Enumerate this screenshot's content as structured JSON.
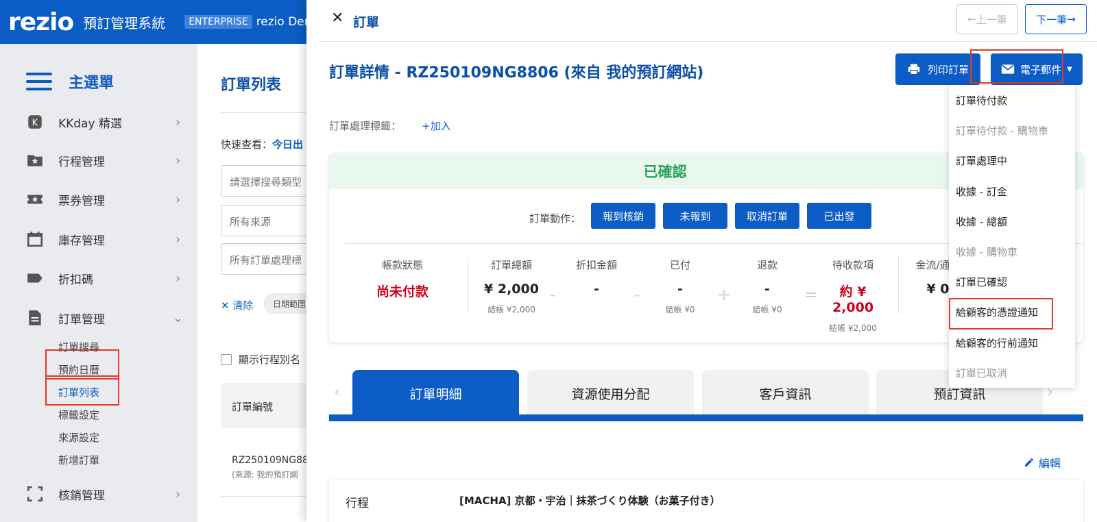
{
  "topbar": {
    "logo": "rezio",
    "app_title": "預訂管理系統",
    "badge": "ENTERPRISE",
    "account": "rezio Dem"
  },
  "sidebar": {
    "menu_title": "主選單",
    "items": [
      {
        "label": "KKday 精選",
        "icon": "kkday-icon"
      },
      {
        "label": "行程管理",
        "icon": "folder-star-icon"
      },
      {
        "label": "票券管理",
        "icon": "ticket-star-icon"
      },
      {
        "label": "庫存管理",
        "icon": "calendar-icon"
      },
      {
        "label": "折扣碼",
        "icon": "tag-icon"
      },
      {
        "label": "訂單管理",
        "icon": "document-icon"
      },
      {
        "label": "核銷管理",
        "icon": "scan-icon"
      }
    ],
    "sub_items": [
      "訂單搜尋",
      "預約日曆",
      "訂單列表",
      "標籤設定",
      "來源設定",
      "新增訂單"
    ]
  },
  "list_panel": {
    "title": "訂單列表",
    "quick_view_label": "快速查看：",
    "quick_view_link": "今日出",
    "search_type_placeholder": "請選擇搜尋類型",
    "source_value": "所有來源",
    "label_value": "所有訂單處理標",
    "clear_label": "✕ 清除",
    "date_range": "日期範圍",
    "show_name_label": "顯示行程別名",
    "col_order_no": "訂單編號",
    "row_order_no": "RZ250109NG88",
    "row_source": "(來源: 我的預訂網"
  },
  "drawer": {
    "title": "訂單",
    "prev_label": "上一筆",
    "next_label": "下一筆",
    "order_title": "訂單詳情 - RZ250109NG8806 (來自 我的預訂網站)",
    "print_label": "列印訂單",
    "email_label": "電子郵件",
    "tag_label": "訂單處理標籤：",
    "tag_add": "+加入",
    "status": "已確認",
    "actions_label": "訂單動作：",
    "actions": [
      "報到核銷",
      "未報到",
      "取消訂單",
      "已出發"
    ],
    "finance": {
      "payment_status_label": "帳款狀態",
      "payment_status": "尚未付款",
      "total_label": "訂單總額",
      "total": "¥ 2,000",
      "total_sub": "結帳 ¥2,000",
      "discount_label": "折扣金額",
      "discount": "-",
      "paid_label": "已付",
      "paid": "-",
      "paid_sub": "結帳 ¥0",
      "refund_label": "退款",
      "refund": "-",
      "refund_sub": "結帳 ¥0",
      "pending_label": "待收款項",
      "pending": "約 ¥ 2,000",
      "pending_sub": "結帳 ¥2,000",
      "flow_label": "金流/通路",
      "flow": "¥ 0"
    },
    "tabs": [
      "訂單明細",
      "資源使用分配",
      "客戶資訊",
      "預訂資訊"
    ],
    "edit_label": "編輯",
    "detail_key": "行程",
    "detail_value": "[MACHA] 京都・宇治｜抹茶づくり体験（お菓子付き）"
  },
  "email_menu": [
    {
      "label": "訂單待付款",
      "disabled": false
    },
    {
      "label": "訂單待付款 - 購物車",
      "disabled": true
    },
    {
      "label": "訂單處理中",
      "disabled": false
    },
    {
      "label": "收據 - 訂金",
      "disabled": false
    },
    {
      "label": "收據 - 總額",
      "disabled": false
    },
    {
      "label": "收據 - 購物車",
      "disabled": true
    },
    {
      "label": "訂單已確認",
      "disabled": false
    },
    {
      "label": "給顧客的憑證通知",
      "disabled": false
    },
    {
      "label": "給顧客的行前通知",
      "disabled": false
    },
    {
      "label": "訂單已取消",
      "disabled": true
    }
  ],
  "colors": {
    "brand": "#0b5cc4",
    "confirmed": "#29a15c",
    "unpaid": "#d0021b",
    "highlight": "#e5392b"
  }
}
